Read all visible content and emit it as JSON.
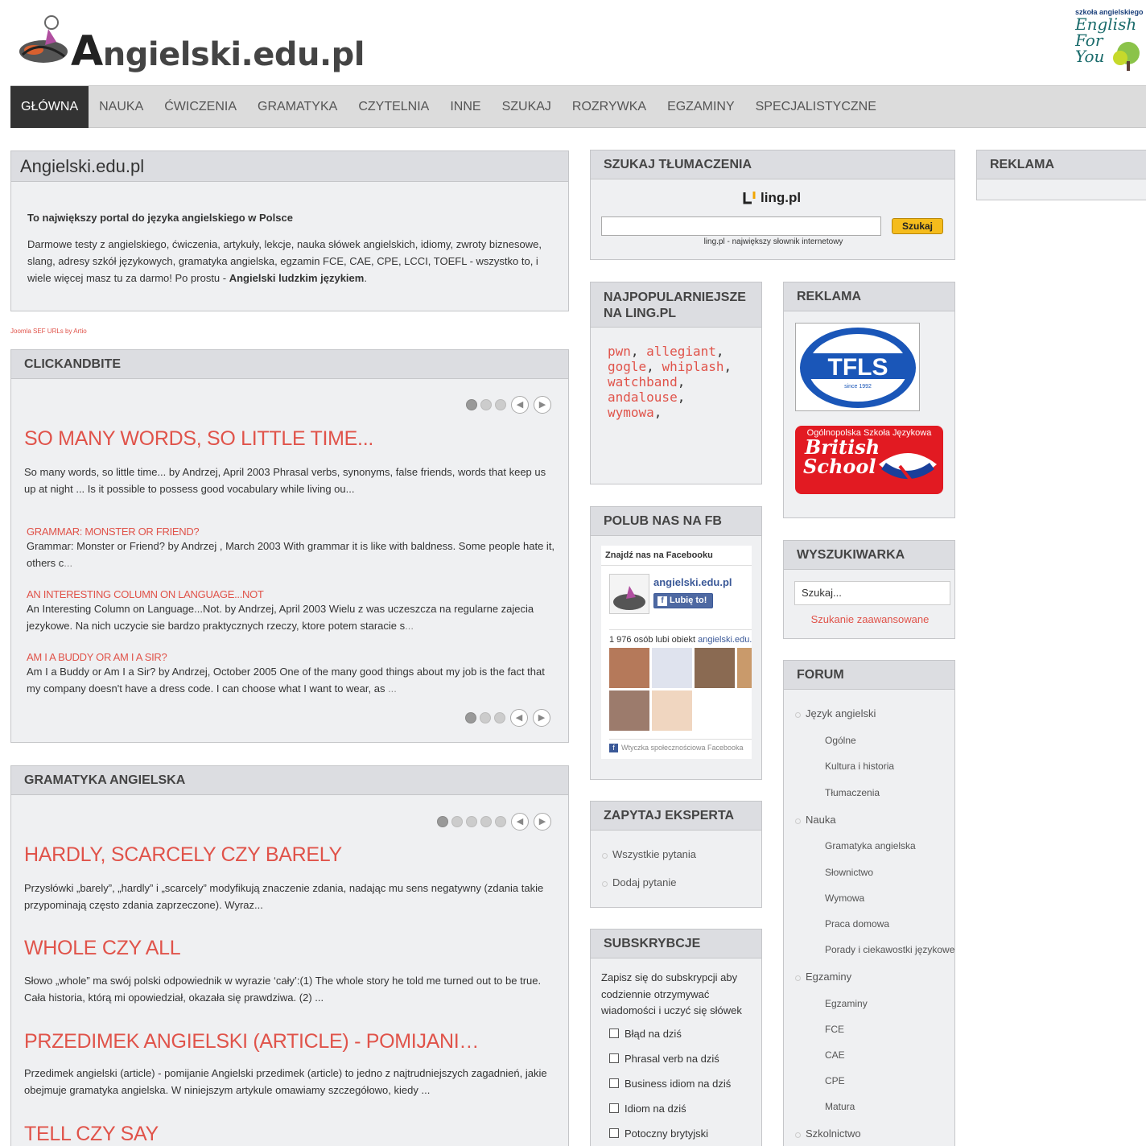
{
  "header": {
    "logo_text": "ngielski.edu.pl",
    "logo_letter": "A",
    "efy_small": "szkoła angielskiego",
    "efy_script": "English For You"
  },
  "nav": [
    "GŁÓWNA",
    "NAUKA",
    "ĆWICZENIA",
    "GRAMATYKA",
    "CZYTELNIA",
    "INNE",
    "SZUKAJ",
    "ROZRYWKA",
    "EGZAMINY",
    "SPECJALISTYCZNE"
  ],
  "intro": {
    "title": "Angielski.edu.pl",
    "lead": "To największy portal do języka angielskiego w Polsce",
    "body": "Darmowe testy z angielskiego, ćwiczenia, artykuły, lekcje, nauka słówek angielskich, idiomy, zwroty biznesowe, slang, adresy szkół językowych, gramatyka angielska, egzamin FCE, CAE, CPE, LCCI, TOEFL - wszystko to, i wiele więcej masz tu za darmo! Po prostu - ",
    "body_bold": "Angielski ludzkim językiem",
    "body_end": "."
  },
  "sef_link": "Joomla SEF URLs by Artio",
  "clickandbite": {
    "title": "CLICKANDBITE",
    "main_title": "SO MANY WORDS, SO LITTLE TIME...",
    "main_text": "So many words, so little time... by Andrzej, April 2003 Phrasal verbs, synonyms, false friends, words that keep us up at night ... Is it possible to possess good vocabulary while living ou...",
    "items": [
      {
        "title": "GRAMMAR: MONSTER OR FRIEND?",
        "text": "Grammar: Monster or Friend? by Andrzej , March 2003 With grammar it is like with baldness. Some people hate it, others c",
        "more": "..."
      },
      {
        "title": "AN INTERESTING COLUMN ON LANGUAGE...NOT",
        "text": "An Interesting Column on Language...Not. by Andrzej, April 2003 Wielu z was uczeszcza na regularne zajecia jezykowe. Na nich uczycie sie bardzo praktycznych rzeczy, ktore potem staracie s",
        "more": "..."
      },
      {
        "title": "AM I A BUDDY OR AM I A SIR?",
        "text": "Am I a Buddy or Am I a Sir? by Andrzej, October 2005 One of the many good things about my job is the fact that my company doesn't have a dress code. I can choose what I want to wear, as ",
        "more": "..."
      }
    ]
  },
  "grammar": {
    "title": "GRAMATYKA ANGIELSKA",
    "articles": [
      {
        "title": "HARDLY, SCARCELY CZY BARELY",
        "text": "Przysłówki „barely”, „hardly” i „scarcely” modyfikują znaczenie zdania, nadając mu sens negatywny (zdania takie przypominają często zdania zaprzeczone). Wyraz..."
      },
      {
        "title": "WHOLE CZY ALL",
        "text": "Słowo „whole” ma swój polski odpowiednik w wyrazie ‘cały’:(1) The whole story he told me turned out to be true. Cała historia, którą mi opowiedział, okazała się prawdziwa. (2) ..."
      },
      {
        "title": "PRZEDIMEK ANGIELSKI (ARTICLE) - POMIJANI…",
        "text": "Przedimek angielski (article) - pomijanie Angielski przedimek (article) to jedno z najtrudniejszych zagadnień, jakie obejmuje gramatyka angielska. W niniejszym artykule omawiamy szczegółowo, kiedy ..."
      },
      {
        "title": "TELL CZY SAY",
        "text": ""
      }
    ]
  },
  "search_translation": {
    "title": "SZUKAJ TŁUMACZENIA",
    "brand": "ling.pl",
    "button": "Szukaj",
    "caption": "ling.pl - największy słownik internetowy"
  },
  "ads_right": {
    "title": "REKLAMA"
  },
  "popular": {
    "title": "NAJPOPULARNIEJSZE NA LING.PL",
    "words": [
      "pwn",
      "allegiant",
      "gogle",
      "whiplash",
      "watchband",
      "andalouse",
      "wymowa"
    ]
  },
  "ads_mid": {
    "title": "REKLAMA",
    "tfls_text": "TFLS",
    "tfls_since": "since 1992",
    "bs_top": "Ogólnopolska Szkoła Językowa",
    "bs_line1": "British",
    "bs_line2": "School"
  },
  "fb": {
    "title": "POLUB NAS NA FB",
    "find": "Znajdź nas na Facebooku",
    "page_name": "angielski.edu.pl",
    "like_btn": "Lubię to!",
    "count_text": "1 976 osób lubi obiekt ",
    "count_link": "angielski.edu.pl",
    "plugin": "Wtyczka społecznościowa Facebooka"
  },
  "search_box": {
    "title": "WYSZUKIWARKA",
    "placeholder": "Szukaj...",
    "advanced": "Szukanie zaawansowane"
  },
  "expert": {
    "title": "ZAPYTAJ EKSPERTA",
    "items": [
      "Wszystkie pytania",
      "Dodaj pytanie"
    ]
  },
  "forum": {
    "title": "FORUM",
    "groups": [
      {
        "label": "Język angielski",
        "subs": [
          "Ogólne",
          "Kultura i historia",
          "Tłumaczenia"
        ]
      },
      {
        "label": "Nauka",
        "subs": [
          "Gramatyka angielska",
          "Słownictwo",
          "Wymowa",
          "Praca domowa",
          "Porady i ciekawostki językowe"
        ]
      },
      {
        "label": "Egzaminy",
        "subs": [
          "Egzaminy",
          "FCE",
          "CAE",
          "CPE",
          "Matura"
        ]
      },
      {
        "label": "Szkolnictwo",
        "subs": []
      }
    ]
  },
  "subs": {
    "title": "SUBSKRYBCJE",
    "text": "Zapisz się do subskrypcji aby codziennie otrzymywać wiadomości i uczyć się słówek",
    "options": [
      "Błąd na dziś",
      "Phrasal verb na dziś",
      "Business idiom na dziś",
      "Idiom na dziś",
      "Potoczny brytyjski"
    ]
  },
  "colors": {
    "accent": "#e0534a",
    "nav_bg": "#dcdcdc",
    "nav_active": "#333333",
    "box_bg": "#eff0f2",
    "box_header": "#dcdde1"
  }
}
